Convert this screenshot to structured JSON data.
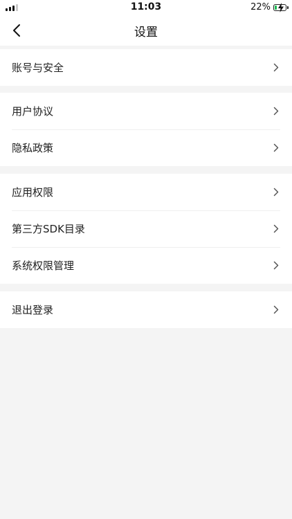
{
  "status_bar": {
    "time": "11:03",
    "battery_percent": "22%",
    "battery_level": 0.22,
    "signal_bars_active": 3,
    "signal_bars_total": 4
  },
  "nav": {
    "title": "设置",
    "back_icon": "chevron-left-icon"
  },
  "groups": [
    {
      "items": [
        {
          "label": "账号与安全",
          "icon": "chevron-right-icon"
        }
      ]
    },
    {
      "items": [
        {
          "label": "用户协议",
          "icon": "chevron-right-icon"
        },
        {
          "label": "隐私政策",
          "icon": "chevron-right-icon"
        }
      ]
    },
    {
      "items": [
        {
          "label": "应用权限",
          "icon": "chevron-right-icon"
        },
        {
          "label": "第三方SDK目录",
          "icon": "chevron-right-icon"
        },
        {
          "label": "系统权限管理",
          "icon": "chevron-right-icon"
        }
      ]
    },
    {
      "items": [
        {
          "label": "退出登录",
          "icon": "chevron-right-icon"
        }
      ]
    }
  ],
  "colors": {
    "background": "#f4f4f4",
    "surface": "#ffffff",
    "text": "#222222",
    "divider": "#efefef",
    "chevron": "#555555",
    "battery_charging": "#1db954"
  }
}
